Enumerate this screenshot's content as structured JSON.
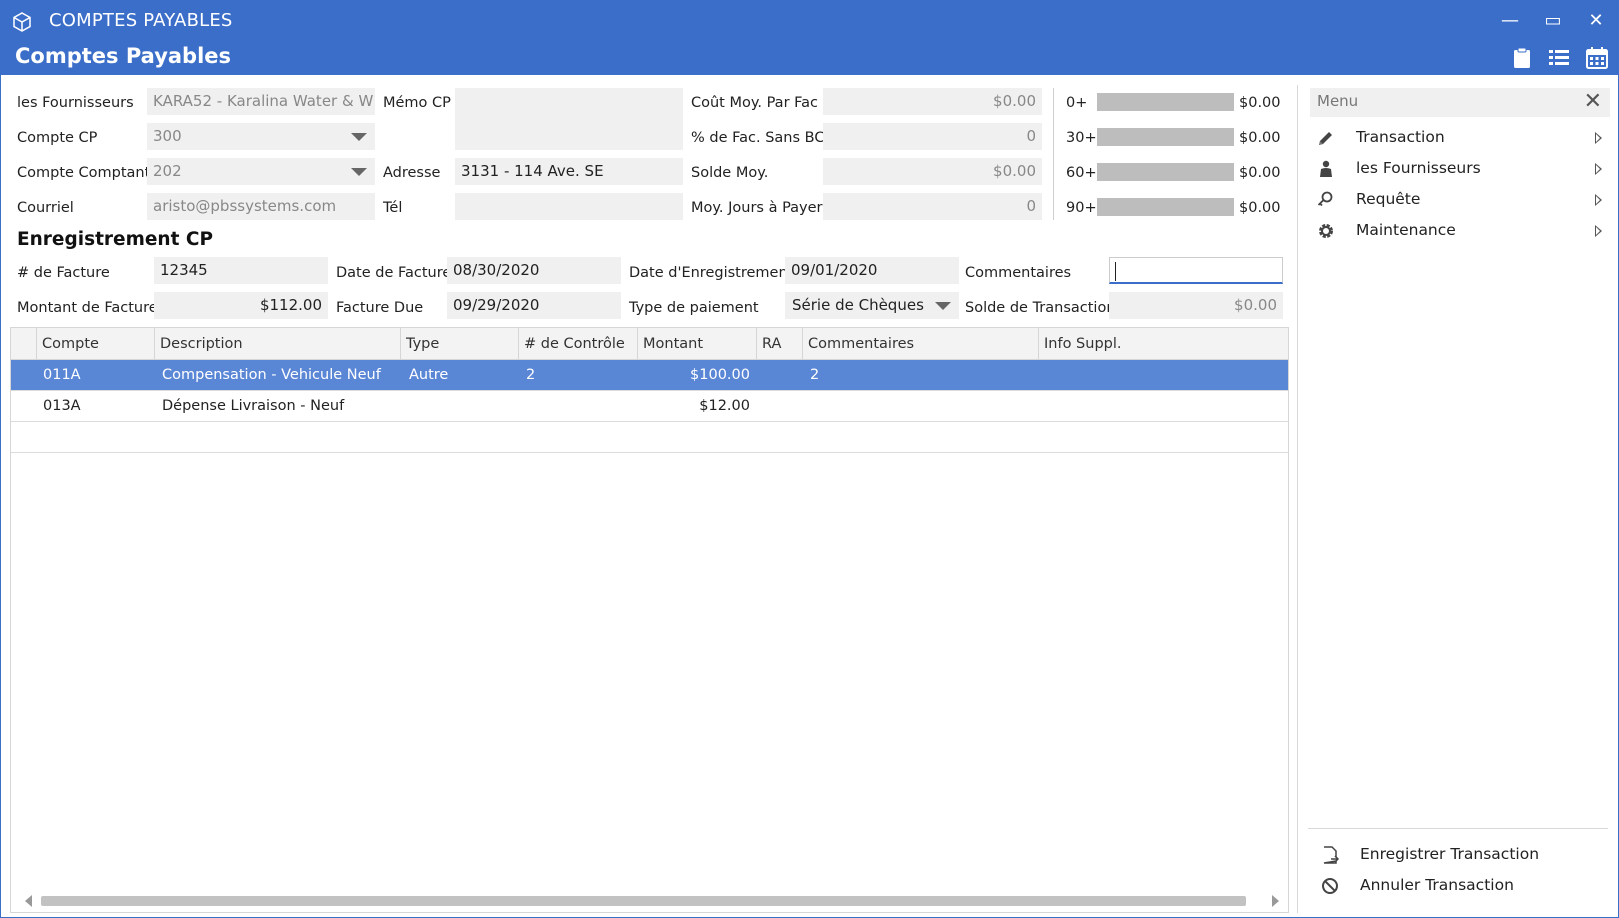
{
  "window": {
    "title": "COMPTES PAYABLES",
    "page_title": "Comptes Payables",
    "controls": {
      "minimize": "—",
      "maximize": "▭",
      "close": "✕"
    }
  },
  "header_icons": [
    "clipboard-icon",
    "list-icon",
    "calendar-icon"
  ],
  "supplier_form": {
    "fournisseur_label": "les Fournisseurs",
    "fournisseur_value": "KARA52 - Karalina Water  & W",
    "compte_cp_label": "Compte CP",
    "compte_cp_value": "300",
    "compte_comptant_label": "Compte Comptant",
    "compte_comptant_value": "202",
    "courriel_label": "Courriel",
    "courriel_value": "aristo@pbssystems.com",
    "memo_label": "Mémo CP",
    "memo_value": "",
    "adresse_label": "Adresse",
    "adresse_value": "3131 - 114 Ave. SE",
    "tel_label": "Tél",
    "tel_value": ""
  },
  "stats": {
    "cout_moy_label": "Coût Moy. Par Fac",
    "cout_moy_value": "$0.00",
    "pct_sans_bc_label": "% de Fac. Sans BC",
    "pct_sans_bc_value": "0",
    "solde_moy_label": "Solde Moy.",
    "solde_moy_value": "$0.00",
    "moy_jours_label": "Moy. Jours à Payer",
    "moy_jours_value": "0"
  },
  "aging": [
    {
      "label": "0+",
      "value": "$0.00"
    },
    {
      "label": "30+",
      "value": "$0.00"
    },
    {
      "label": "60+",
      "value": "$0.00"
    },
    {
      "label": "90+",
      "value": "$0.00"
    }
  ],
  "registration": {
    "section_title": "Enregistrement CP",
    "facture_num_label": "# de Facture",
    "facture_num_value": "12345",
    "date_facture_label": "Date de Facture",
    "date_facture_value": "08/30/2020",
    "date_enreg_label": "Date d'Enregistrement",
    "date_enreg_value": "09/01/2020",
    "commentaires_label": "Commentaires",
    "commentaires_value": "",
    "montant_label": "Montant de Facture",
    "montant_value": "$112.00",
    "facture_due_label": "Facture Due",
    "facture_due_value": "09/29/2020",
    "type_paiement_label": "Type de paiement",
    "type_paiement_value": "Série de Chèques",
    "solde_trans_label": "Solde de Transaction",
    "solde_trans_value": "$0.00"
  },
  "grid": {
    "columns": [
      "Compte",
      "Description",
      "Type",
      "# de Contrôle",
      "Montant",
      "RA",
      "Commentaires",
      "Info Suppl."
    ],
    "rows": [
      {
        "compte": "011A",
        "description": "Compensation - Vehicule Neuf",
        "type": "Autre",
        "controle": "2",
        "montant": "$100.00",
        "ra": "",
        "commentaires": "2",
        "info": "",
        "selected": true
      },
      {
        "compte": "013A",
        "description": "Dépense Livraison - Neuf",
        "type": "",
        "controle": "",
        "montant": "$12.00",
        "ra": "",
        "commentaires": "",
        "info": "",
        "selected": false
      }
    ]
  },
  "menu": {
    "title": "Menu",
    "items": [
      {
        "label": "Transaction",
        "icon": "pencil-icon"
      },
      {
        "label": "les Fournisseurs",
        "icon": "person-icon"
      },
      {
        "label": "Requête",
        "icon": "search-key-icon"
      },
      {
        "label": "Maintenance",
        "icon": "gear-icon"
      }
    ],
    "actions": [
      {
        "label": "Enregistrer Transaction",
        "icon": "save-document-icon"
      },
      {
        "label": "Annuler Transaction",
        "icon": "cancel-icon"
      }
    ]
  },
  "colors": {
    "accent": "#3b6ec9",
    "selected_row": "#5a86d6",
    "field_bg": "#f0f0f0"
  }
}
